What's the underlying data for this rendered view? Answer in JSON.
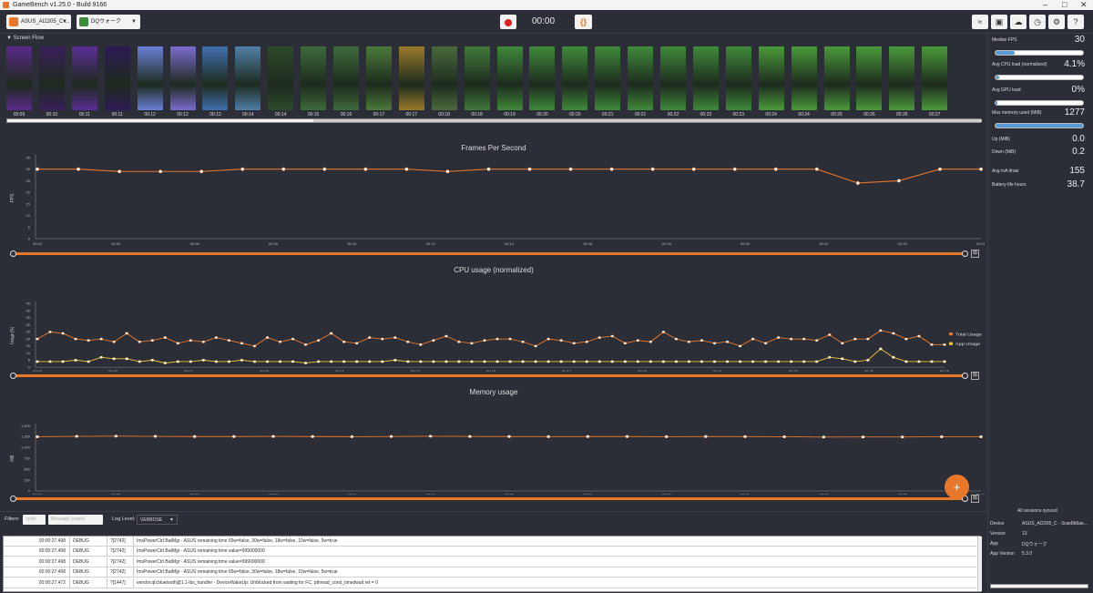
{
  "window": {
    "title": "GameBench v1.25.0 - Build 9166"
  },
  "toolbar": {
    "device_select": "ASUS_AI2205_C ...",
    "app_select": "DQウォーク",
    "timer": "00:00",
    "braces_label": "{}"
  },
  "screen_flow": {
    "label": "Screen Flow",
    "times": [
      "00:09",
      "00:10",
      "00:11",
      "00:11",
      "00:12",
      "00:12",
      "00:13",
      "00:14",
      "00:14",
      "00:15",
      "00:16",
      "00:17",
      "00:17",
      "00:18",
      "00:18",
      "00:19",
      "00:20",
      "00:20",
      "00:21",
      "00:21",
      "00:22",
      "00:23",
      "00:23",
      "00:24",
      "00:24",
      "00:25",
      "00:26",
      "00:26",
      "00:27"
    ],
    "thumb_colors": [
      "#5a2a8a",
      "#3a1f5c",
      "#5b2d96",
      "#2d1a55",
      "#6a7fd8",
      "#7b6bd0",
      "#3f6fae",
      "#4f7fa8",
      "#2e4a2a",
      "#3d6b3a",
      "#3d6b3a",
      "#4a7a3a",
      "#9a7a2a",
      "#4a6a3a",
      "#3f7a3a",
      "#3f8a3a",
      "#3f8a3a",
      "#3f8a3a",
      "#3f8a3a",
      "#3f8a3a",
      "#3f8a3a",
      "#3f8a3a",
      "#3f8a3a",
      "#4a9a3a",
      "#4a9a3a",
      "#4a9a3a",
      "#4a9a3a",
      "#4a9a3a",
      "#4a9a3a"
    ]
  },
  "charts": {
    "fps": {
      "title": "Frames Per Second",
      "ylabel": "FPS",
      "y_ticks": [
        "35",
        "30",
        "25",
        "20",
        "15",
        "10",
        "5",
        "0"
      ],
      "x_ticks": [
        "00:02",
        "00:04",
        "00:06",
        "00:08",
        "00:10",
        "00:12",
        "00:14",
        "00:16",
        "00:18",
        "00:20",
        "00:22",
        "00:24",
        "00:25"
      ]
    },
    "cpu": {
      "title": "CPU usage (normalized)",
      "ylabel": "Usage (%)",
      "y_ticks": [
        "45",
        "40",
        "35",
        "30",
        "25",
        "20",
        "15",
        "10",
        "5",
        "0"
      ],
      "x_ticks": [
        "00:03",
        "00:05",
        "00:07",
        "00:09",
        "00:11",
        "00:13",
        "00:15",
        "00:17",
        "00:19",
        "00:21",
        "00:23",
        "00:25",
        "00:26"
      ],
      "legend": [
        "Total Usage",
        "App Usage"
      ]
    },
    "memory": {
      "title": "Memory usage",
      "ylabel": "MiB",
      "y_ticks": [
        "1,500",
        "1,250",
        "1,000",
        "750",
        "500",
        "250",
        "0"
      ],
      "x_ticks": [
        "00:03",
        "00:05",
        "00:07",
        "00:09",
        "00:11",
        "00:13",
        "00:15",
        "00:17",
        "00:19",
        "00:21",
        "00:23",
        "00:25",
        "00:27"
      ]
    }
  },
  "chart_data": [
    {
      "type": "line",
      "title": "Frames Per Second",
      "ylabel": "FPS",
      "ylim": [
        0,
        35
      ],
      "x": [
        2,
        3,
        4,
        5,
        6,
        7,
        8,
        9,
        10,
        11,
        12,
        13,
        14,
        15,
        16,
        17,
        18,
        19,
        20,
        21,
        22,
        23,
        24,
        25
      ],
      "series": [
        {
          "values": [
            30,
            30,
            29,
            29,
            29,
            30,
            30,
            30,
            30,
            30,
            29,
            30,
            30,
            30,
            30,
            30,
            30,
            30,
            30,
            30,
            24,
            25,
            30,
            30
          ]
        }
      ]
    },
    {
      "type": "line",
      "title": "CPU usage (normalized)",
      "ylabel": "Usage (%)",
      "ylim": [
        0,
        45
      ],
      "x_range": [
        3,
        26
      ],
      "series": [
        {
          "name": "Total Usage",
          "color": "#e8772a",
          "values": [
            20,
            25,
            24,
            20,
            19,
            20,
            18,
            24,
            18,
            19,
            21,
            17,
            19,
            18,
            21,
            19,
            17,
            15,
            21,
            18,
            20,
            16,
            19,
            24,
            18,
            17,
            21,
            20,
            21,
            18,
            16,
            19,
            22,
            18,
            17,
            19,
            20,
            20,
            18,
            15,
            20,
            19,
            17,
            18,
            21,
            22,
            17,
            19,
            18,
            25,
            20,
            18,
            19,
            17,
            18,
            15,
            20,
            17,
            21,
            20,
            20,
            19,
            23,
            17,
            20,
            20,
            26,
            24,
            20,
            22,
            16,
            16
          ]
        },
        {
          "name": "App Usage",
          "color": "#f1c232",
          "values": [
            4,
            4,
            4,
            5,
            4,
            7,
            6,
            6,
            4,
            5,
            3,
            4,
            4,
            5,
            4,
            4,
            5,
            4,
            4,
            4,
            4,
            3,
            4,
            4,
            4,
            4,
            4,
            4,
            5,
            4,
            4,
            4,
            4,
            4,
            4,
            4,
            4,
            4,
            4,
            4,
            4,
            4,
            4,
            4,
            4,
            4,
            4,
            4,
            4,
            4,
            4,
            4,
            4,
            4,
            4,
            4,
            4,
            4,
            4,
            4,
            4,
            4,
            7,
            6,
            4,
            5,
            13,
            7,
            4,
            4,
            4,
            4
          ]
        }
      ]
    },
    {
      "type": "line",
      "title": "Memory usage",
      "ylabel": "MiB",
      "ylim": [
        0,
        1500
      ],
      "x_range": [
        3,
        27
      ],
      "series": [
        {
          "values": [
            1250,
            1260,
            1265,
            1260,
            1255,
            1255,
            1258,
            1255,
            1252,
            1257,
            1262,
            1257,
            1255,
            1253,
            1255,
            1255,
            1252,
            1255,
            1254,
            1250,
            1244,
            1245,
            1245,
            1250,
            1250
          ]
        }
      ]
    }
  ],
  "stats": [
    {
      "label": "Median FPS",
      "value": "30",
      "bar": 0.22
    },
    {
      "label": "Avg CPU load (normalized)",
      "value": "4.1%",
      "bar": 0.041
    },
    {
      "label": "Avg GPU load",
      "value": "0%",
      "bar": 0.0
    },
    {
      "label": "Max memory used (MiB)",
      "value": "1277",
      "bar": 1.0
    },
    {
      "label": "Up (MiB)",
      "value": "0.0"
    },
    {
      "label": "Down (MiB)",
      "value": "0.2"
    },
    {
      "label": "Avg mA draw",
      "value": "155"
    },
    {
      "label": "Battery life hours",
      "value": "38.7"
    }
  ],
  "logs": {
    "filters_label": "Filters:",
    "pid_placeholder": "<pid>",
    "message_placeholder": "Message (regex)",
    "level_label": "Log Level:",
    "level_value": "VERBOSE",
    "rows": [
      {
        "time": "00:00:27.498",
        "level": "DEBUG",
        "pid": "?[2742]",
        "msg": "ImsPowerCtrl.BatMgr - ASUS remaining time 65w=false, 30w=false, 18w=false, 10w=false, 5w=true"
      },
      {
        "time": "00:00:27.498",
        "level": "DEBUG",
        "pid": "?[2742]",
        "msg": "ImsPowerCtrl.BatMgr - ASUS remaining time value=999000000"
      },
      {
        "time": "00:00:27.498",
        "level": "DEBUG",
        "pid": "?[2742]",
        "msg": "ImsPowerCtrl.BatMgr - ASUS remaining time value=999000000"
      },
      {
        "time": "00:00:27.498",
        "level": "DEBUG",
        "pid": "?[2742]",
        "msg": "ImsPowerCtrl.BatMgr - ASUS remaining time 65w=false, 30w=false, 18w=false, 10w=false, 5w=true"
      },
      {
        "time": "00:00:27.472",
        "level": "DEBUG",
        "pid": "?[1447]",
        "msg": "vendor.qti.bluetooth@1.1-ibs_handler - DeviceWakeUp: Unblocked from waiting for FC, pthread_cond_timedwait ret = 0"
      }
    ]
  },
  "device_info": {
    "synced": "All sessions synced",
    "rows": [
      {
        "label": "Device",
        "value": "ASUS_AI2205_C - 3cae8b6ae..."
      },
      {
        "label": "Version",
        "value": "13"
      },
      {
        "label": "App",
        "value": "DQウォーク"
      },
      {
        "label": "App Version",
        "value": "5.3.0"
      }
    ]
  }
}
